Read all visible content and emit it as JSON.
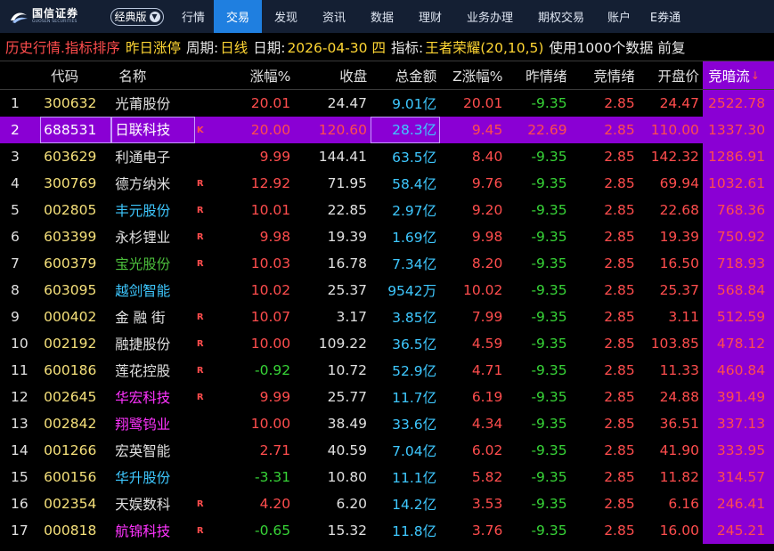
{
  "app": {
    "logo_cn": "国信证券",
    "logo_en": "GUOSEN SECURITIES",
    "version_label": "经典版"
  },
  "nav": [
    {
      "label": "行情",
      "active": false,
      "w": 46
    },
    {
      "label": "交易",
      "active": true,
      "w": 54
    },
    {
      "label": "发现",
      "active": false,
      "w": 54
    },
    {
      "label": "资讯",
      "active": false,
      "w": 54
    },
    {
      "label": "数据",
      "active": false,
      "w": 54
    },
    {
      "label": "理财",
      "active": false,
      "w": 54
    },
    {
      "label": "业务办理",
      "active": false,
      "w": 80
    },
    {
      "label": "期权交易",
      "active": false,
      "w": 80
    },
    {
      "label": "账户",
      "active": false,
      "w": 50
    },
    {
      "label": "E券通",
      "active": false,
      "w": 54
    }
  ],
  "infobar": {
    "part1": "历史行情.指标排序",
    "part2": "昨日涨停",
    "part3": "周期:",
    "part4": "日线",
    "part5": "日期:",
    "part6": "2026-04-30 四",
    "part7": "指标:",
    "part8": "王者荣耀(20,10,5)",
    "part9": "使用1000个数据 前复"
  },
  "headers": {
    "code": "代码",
    "name": "名称",
    "chg": "涨幅%",
    "close": "收盘",
    "amount": "总金额",
    "z": "Z涨幅%",
    "ymood": "昨情绪",
    "jmood": "竞情绪",
    "open": "开盘价",
    "flow": "竞暗流",
    "flow_mark": "↓"
  },
  "rows": [
    {
      "idx": "1",
      "code": "300632",
      "name": "光莆股份",
      "flag": "",
      "name_color": "white",
      "chg": "20.01",
      "chg_color": "red",
      "close": "24.47",
      "amount": "9.01亿",
      "z": "20.01",
      "ymood": "-9.35",
      "ymood_color": "green",
      "jmood": "2.85",
      "open": "24.47",
      "open_color": "red",
      "flow": "2522.78"
    },
    {
      "idx": "2",
      "code": "688531",
      "name": "日联科技",
      "flag": "K",
      "name_color": "white",
      "chg": "20.00",
      "chg_color": "red",
      "close": "120.60",
      "amount": "28.3亿",
      "z": "9.45",
      "ymood": "22.69",
      "ymood_color": "red",
      "jmood": "2.85",
      "open": "110.00",
      "open_color": "red",
      "flow": "1337.30",
      "selected": true
    },
    {
      "idx": "3",
      "code": "603629",
      "name": "利通电子",
      "flag": "",
      "name_color": "white",
      "chg": "9.99",
      "chg_color": "red",
      "close": "144.41",
      "amount": "63.5亿",
      "z": "8.40",
      "ymood": "-9.35",
      "ymood_color": "green",
      "jmood": "2.85",
      "open": "142.32",
      "open_color": "red",
      "flow": "1286.91"
    },
    {
      "idx": "4",
      "code": "300769",
      "name": "德方纳米",
      "flag": "R",
      "name_color": "white",
      "chg": "12.92",
      "chg_color": "red",
      "close": "71.95",
      "amount": "58.4亿",
      "z": "9.76",
      "ymood": "-9.35",
      "ymood_color": "green",
      "jmood": "2.85",
      "open": "69.94",
      "open_color": "red",
      "flow": "1032.61"
    },
    {
      "idx": "5",
      "code": "002805",
      "name": "丰元股份",
      "flag": "R",
      "name_color": "cyan",
      "chg": "10.01",
      "chg_color": "red",
      "close": "22.85",
      "amount": "2.97亿",
      "z": "9.20",
      "ymood": "-9.35",
      "ymood_color": "green",
      "jmood": "2.85",
      "open": "22.68",
      "open_color": "red",
      "flow": "768.36"
    },
    {
      "idx": "6",
      "code": "603399",
      "name": "永杉锂业",
      "flag": "R",
      "name_color": "white",
      "chg": "9.98",
      "chg_color": "red",
      "close": "19.39",
      "amount": "1.69亿",
      "z": "9.98",
      "ymood": "-9.35",
      "ymood_color": "green",
      "jmood": "2.85",
      "open": "19.39",
      "open_color": "red",
      "flow": "750.92"
    },
    {
      "idx": "7",
      "code": "600379",
      "name": "宝光股份",
      "flag": "R",
      "name_color": "olive",
      "chg": "10.03",
      "chg_color": "red",
      "close": "16.78",
      "amount": "7.34亿",
      "z": "8.20",
      "ymood": "-9.35",
      "ymood_color": "green",
      "jmood": "2.85",
      "open": "16.50",
      "open_color": "red",
      "flow": "718.93"
    },
    {
      "idx": "8",
      "code": "603095",
      "name": "越剑智能",
      "flag": "",
      "name_color": "cyan",
      "chg": "10.02",
      "chg_color": "red",
      "close": "25.37",
      "amount": "9542万",
      "z": "10.02",
      "ymood": "-9.35",
      "ymood_color": "green",
      "jmood": "2.85",
      "open": "25.37",
      "open_color": "red",
      "flow": "568.84"
    },
    {
      "idx": "9",
      "code": "000402",
      "name": "金 融 街",
      "flag": "R",
      "name_color": "white",
      "chg": "10.07",
      "chg_color": "red",
      "close": "3.17",
      "amount": "3.85亿",
      "z": "7.99",
      "ymood": "-9.35",
      "ymood_color": "green",
      "jmood": "2.85",
      "open": "3.11",
      "open_color": "red",
      "flow": "512.59"
    },
    {
      "idx": "10",
      "code": "002192",
      "name": "融捷股份",
      "flag": "R",
      "name_color": "white",
      "chg": "10.00",
      "chg_color": "red",
      "close": "109.22",
      "amount": "36.5亿",
      "z": "4.59",
      "ymood": "-9.35",
      "ymood_color": "green",
      "jmood": "2.85",
      "open": "103.85",
      "open_color": "red",
      "flow": "478.12"
    },
    {
      "idx": "11",
      "code": "600186",
      "name": "莲花控股",
      "flag": "R",
      "name_color": "white",
      "chg": "-0.92",
      "chg_color": "green",
      "close": "10.72",
      "amount": "52.9亿",
      "z": "4.71",
      "ymood": "-9.35",
      "ymood_color": "green",
      "jmood": "2.85",
      "open": "11.33",
      "open_color": "red",
      "flow": "460.84"
    },
    {
      "idx": "12",
      "code": "002645",
      "name": "华宏科技",
      "flag": "R",
      "name_color": "magenta",
      "chg": "9.99",
      "chg_color": "red",
      "close": "25.77",
      "amount": "11.7亿",
      "z": "6.19",
      "ymood": "-9.35",
      "ymood_color": "green",
      "jmood": "2.85",
      "open": "24.88",
      "open_color": "red",
      "flow": "391.49"
    },
    {
      "idx": "13",
      "code": "002842",
      "name": "翔鹭钨业",
      "flag": "",
      "name_color": "magenta",
      "chg": "10.00",
      "chg_color": "red",
      "close": "38.49",
      "amount": "33.6亿",
      "z": "4.34",
      "ymood": "-9.35",
      "ymood_color": "green",
      "jmood": "2.85",
      "open": "36.51",
      "open_color": "red",
      "flow": "337.13"
    },
    {
      "idx": "14",
      "code": "001266",
      "name": "宏英智能",
      "flag": "",
      "name_color": "white",
      "chg": "2.71",
      "chg_color": "red",
      "close": "40.59",
      "amount": "7.04亿",
      "z": "6.02",
      "ymood": "-9.35",
      "ymood_color": "green",
      "jmood": "2.85",
      "open": "41.90",
      "open_color": "red",
      "flow": "333.95"
    },
    {
      "idx": "15",
      "code": "600156",
      "name": "华升股份",
      "flag": "",
      "name_color": "cyan",
      "chg": "-3.31",
      "chg_color": "green",
      "close": "10.80",
      "amount": "11.1亿",
      "z": "5.82",
      "ymood": "-9.35",
      "ymood_color": "green",
      "jmood": "2.85",
      "open": "11.82",
      "open_color": "red",
      "flow": "314.57"
    },
    {
      "idx": "16",
      "code": "002354",
      "name": "天娱数科",
      "flag": "R",
      "name_color": "white",
      "chg": "4.20",
      "chg_color": "red",
      "close": "6.20",
      "amount": "14.2亿",
      "z": "3.53",
      "ymood": "-9.35",
      "ymood_color": "green",
      "jmood": "2.85",
      "open": "6.16",
      "open_color": "red",
      "flow": "246.41"
    },
    {
      "idx": "17",
      "code": "000818",
      "name": "航锦科技",
      "flag": "R",
      "name_color": "magenta",
      "chg": "-0.65",
      "chg_color": "green",
      "close": "15.32",
      "amount": "11.8亿",
      "z": "3.76",
      "ymood": "-9.35",
      "ymood_color": "green",
      "jmood": "2.85",
      "open": "16.00",
      "open_color": "red",
      "flow": "245.21"
    }
  ]
}
